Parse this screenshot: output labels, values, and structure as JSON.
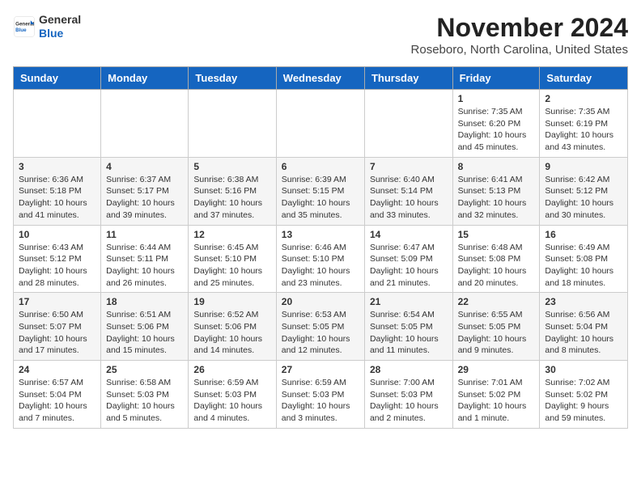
{
  "header": {
    "logo_line1": "General",
    "logo_line2": "Blue",
    "month": "November 2024",
    "location": "Roseboro, North Carolina, United States"
  },
  "weekdays": [
    "Sunday",
    "Monday",
    "Tuesday",
    "Wednesday",
    "Thursday",
    "Friday",
    "Saturday"
  ],
  "weeks": [
    [
      {
        "day": "",
        "info": ""
      },
      {
        "day": "",
        "info": ""
      },
      {
        "day": "",
        "info": ""
      },
      {
        "day": "",
        "info": ""
      },
      {
        "day": "",
        "info": ""
      },
      {
        "day": "1",
        "info": "Sunrise: 7:35 AM\nSunset: 6:20 PM\nDaylight: 10 hours and 45 minutes."
      },
      {
        "day": "2",
        "info": "Sunrise: 7:35 AM\nSunset: 6:19 PM\nDaylight: 10 hours and 43 minutes."
      }
    ],
    [
      {
        "day": "3",
        "info": "Sunrise: 6:36 AM\nSunset: 5:18 PM\nDaylight: 10 hours and 41 minutes."
      },
      {
        "day": "4",
        "info": "Sunrise: 6:37 AM\nSunset: 5:17 PM\nDaylight: 10 hours and 39 minutes."
      },
      {
        "day": "5",
        "info": "Sunrise: 6:38 AM\nSunset: 5:16 PM\nDaylight: 10 hours and 37 minutes."
      },
      {
        "day": "6",
        "info": "Sunrise: 6:39 AM\nSunset: 5:15 PM\nDaylight: 10 hours and 35 minutes."
      },
      {
        "day": "7",
        "info": "Sunrise: 6:40 AM\nSunset: 5:14 PM\nDaylight: 10 hours and 33 minutes."
      },
      {
        "day": "8",
        "info": "Sunrise: 6:41 AM\nSunset: 5:13 PM\nDaylight: 10 hours and 32 minutes."
      },
      {
        "day": "9",
        "info": "Sunrise: 6:42 AM\nSunset: 5:12 PM\nDaylight: 10 hours and 30 minutes."
      }
    ],
    [
      {
        "day": "10",
        "info": "Sunrise: 6:43 AM\nSunset: 5:12 PM\nDaylight: 10 hours and 28 minutes."
      },
      {
        "day": "11",
        "info": "Sunrise: 6:44 AM\nSunset: 5:11 PM\nDaylight: 10 hours and 26 minutes."
      },
      {
        "day": "12",
        "info": "Sunrise: 6:45 AM\nSunset: 5:10 PM\nDaylight: 10 hours and 25 minutes."
      },
      {
        "day": "13",
        "info": "Sunrise: 6:46 AM\nSunset: 5:10 PM\nDaylight: 10 hours and 23 minutes."
      },
      {
        "day": "14",
        "info": "Sunrise: 6:47 AM\nSunset: 5:09 PM\nDaylight: 10 hours and 21 minutes."
      },
      {
        "day": "15",
        "info": "Sunrise: 6:48 AM\nSunset: 5:08 PM\nDaylight: 10 hours and 20 minutes."
      },
      {
        "day": "16",
        "info": "Sunrise: 6:49 AM\nSunset: 5:08 PM\nDaylight: 10 hours and 18 minutes."
      }
    ],
    [
      {
        "day": "17",
        "info": "Sunrise: 6:50 AM\nSunset: 5:07 PM\nDaylight: 10 hours and 17 minutes."
      },
      {
        "day": "18",
        "info": "Sunrise: 6:51 AM\nSunset: 5:06 PM\nDaylight: 10 hours and 15 minutes."
      },
      {
        "day": "19",
        "info": "Sunrise: 6:52 AM\nSunset: 5:06 PM\nDaylight: 10 hours and 14 minutes."
      },
      {
        "day": "20",
        "info": "Sunrise: 6:53 AM\nSunset: 5:05 PM\nDaylight: 10 hours and 12 minutes."
      },
      {
        "day": "21",
        "info": "Sunrise: 6:54 AM\nSunset: 5:05 PM\nDaylight: 10 hours and 11 minutes."
      },
      {
        "day": "22",
        "info": "Sunrise: 6:55 AM\nSunset: 5:05 PM\nDaylight: 10 hours and 9 minutes."
      },
      {
        "day": "23",
        "info": "Sunrise: 6:56 AM\nSunset: 5:04 PM\nDaylight: 10 hours and 8 minutes."
      }
    ],
    [
      {
        "day": "24",
        "info": "Sunrise: 6:57 AM\nSunset: 5:04 PM\nDaylight: 10 hours and 7 minutes."
      },
      {
        "day": "25",
        "info": "Sunrise: 6:58 AM\nSunset: 5:03 PM\nDaylight: 10 hours and 5 minutes."
      },
      {
        "day": "26",
        "info": "Sunrise: 6:59 AM\nSunset: 5:03 PM\nDaylight: 10 hours and 4 minutes."
      },
      {
        "day": "27",
        "info": "Sunrise: 6:59 AM\nSunset: 5:03 PM\nDaylight: 10 hours and 3 minutes."
      },
      {
        "day": "28",
        "info": "Sunrise: 7:00 AM\nSunset: 5:03 PM\nDaylight: 10 hours and 2 minutes."
      },
      {
        "day": "29",
        "info": "Sunrise: 7:01 AM\nSunset: 5:02 PM\nDaylight: 10 hours and 1 minute."
      },
      {
        "day": "30",
        "info": "Sunrise: 7:02 AM\nSunset: 5:02 PM\nDaylight: 9 hours and 59 minutes."
      }
    ]
  ]
}
